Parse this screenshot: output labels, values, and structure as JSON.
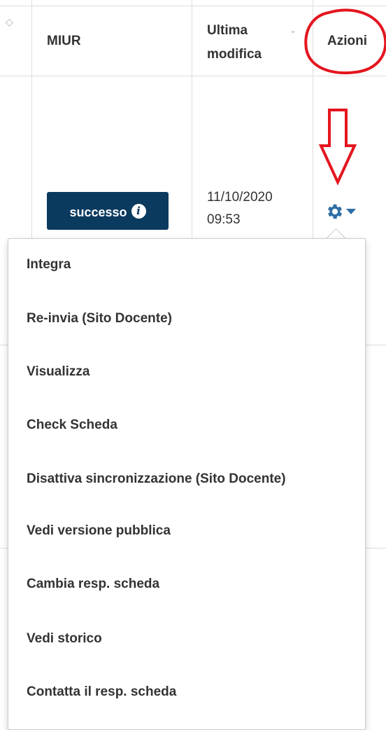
{
  "table": {
    "headers": {
      "miur": "MIUR",
      "ultima_modifica_line1": "Ultima",
      "ultima_modifica_line2": "modifica",
      "azioni": "Azioni"
    },
    "row": {
      "status_badge": "successo",
      "date_line1": "11/10/2020",
      "date_line2": "09:53"
    }
  },
  "actions_menu": {
    "items": [
      "Integra",
      "Re-invia (Sito Docente)",
      "Visualizza",
      "Check Scheda",
      "Disattiva sincronizzazione (Sito Docente)",
      "Vedi versione pubblica",
      "Cambia resp. scheda",
      "Vedi storico",
      "Contatta il resp. scheda"
    ]
  },
  "icons": {
    "gear": "gear-icon",
    "caret": "caret-down-icon",
    "info": "info-icon",
    "sort": "sort-icon"
  },
  "colors": {
    "badge_bg": "#0b3a5f",
    "gear": "#2f6ea5",
    "annotation": "#e4151f",
    "border": "#dddddd"
  }
}
